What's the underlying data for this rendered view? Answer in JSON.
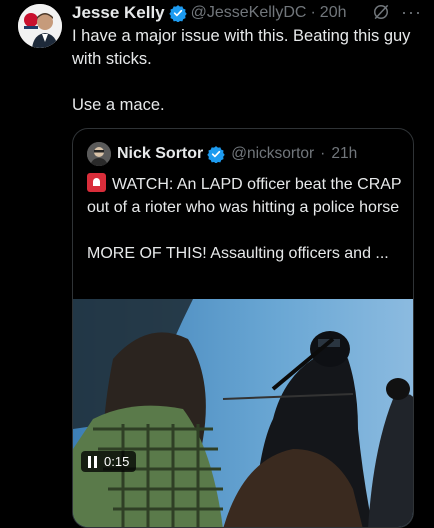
{
  "post": {
    "author_name": "Jesse Kelly",
    "author_handle": "@JesseKellyDC",
    "separator": "·",
    "time": "20h",
    "text_line1": "I have a major issue with this. Beating this guy with sticks.",
    "text_line2": "Use a mace."
  },
  "quote": {
    "author_name": "Nick Sortor",
    "author_handle": "@nicksortor",
    "separator": "·",
    "time": "21h",
    "text_line1": "WATCH: An LAPD officer beat the CRAP out of a rioter who was hitting a police horse",
    "text_line2": "MORE OF THIS! Assaulting officers and ...",
    "video": {
      "duration": "0:15"
    }
  },
  "icons": {
    "verified": "verified-badge-icon",
    "grok": "grok-icon",
    "more": "more-icon",
    "siren": "siren-emoji-icon",
    "pause": "pause-icon"
  },
  "colors": {
    "background": "#000000",
    "text": "#e7e9ea",
    "muted": "#71767b",
    "verified": "#1d9bf0",
    "border": "#2f3336",
    "siren": "#d92d3a"
  }
}
